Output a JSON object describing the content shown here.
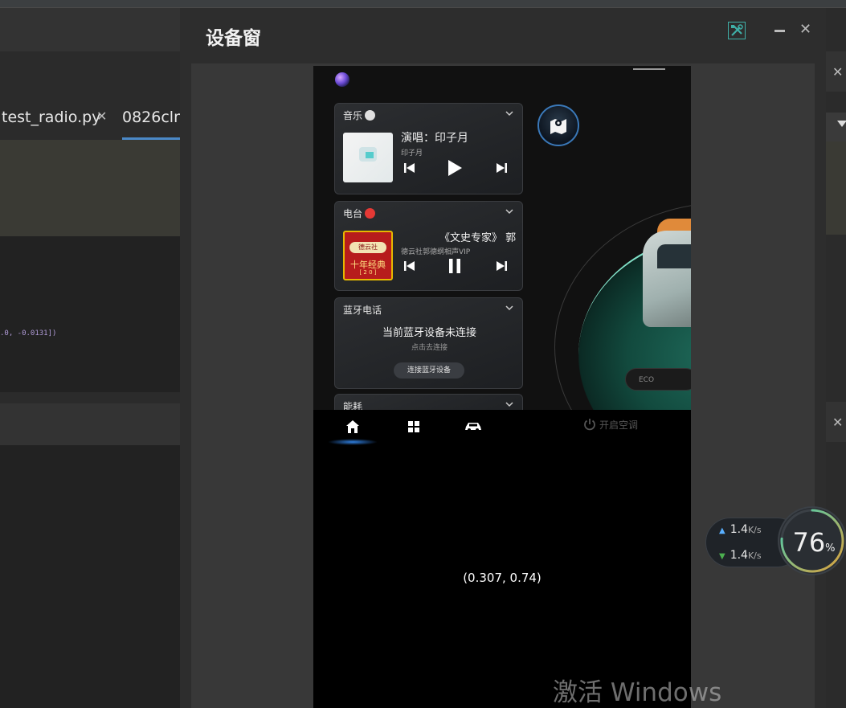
{
  "ide": {
    "tabs": [
      {
        "label": "test_radio.py"
      },
      {
        "label": "0826cln"
      }
    ],
    "console_line": ".0, -0.0131])"
  },
  "device_window": {
    "title": "设备窗"
  },
  "screen": {
    "music": {
      "title": "音乐",
      "song": "演唱：印子月",
      "artist": "印子月"
    },
    "radio": {
      "title": "电台",
      "song": "《文史专家》 郭",
      "artist": "德云社郭德纲相声VIP",
      "album_sub": "德云社",
      "album_main": "十年经典",
      "album_tiny": "[ 2 0 ]"
    },
    "bluetooth": {
      "title": "蓝牙电话",
      "status": "当前蓝牙设备未连接",
      "hint": "点击去连接",
      "button": "连接蓝牙设备"
    },
    "energy": {
      "title": "能耗"
    },
    "eco_label": "ECO",
    "ac_label": "开启空调",
    "coordinate_readout": "(0.307, 0.74)"
  },
  "net_widget": {
    "up_speed": "1.4",
    "down_speed": "1.4",
    "unit": "K/s",
    "cpu_percent": "76",
    "percent_sign": "%",
    "cpu_fraction": 0.76
  },
  "watermark": "激活 Windows",
  "colors": {
    "accent_blue": "#4a88c7",
    "gauge_gradient_start": "#e0a23a",
    "gauge_gradient_end": "#3fd0b8"
  }
}
